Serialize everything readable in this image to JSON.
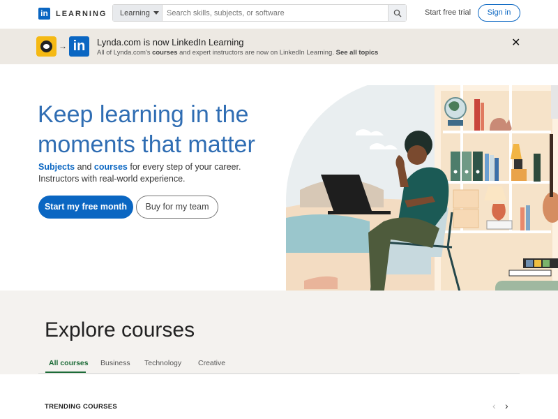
{
  "header": {
    "logo_text": "LEARNING",
    "logo_mark": "in",
    "search": {
      "scope": "Learning",
      "placeholder": "Search skills, subjects, or software"
    },
    "start_trial": "Start free trial",
    "signin": "Sign in"
  },
  "banner": {
    "title": "Lynda.com is now LinkedIn Learning",
    "sub_prefix": "All of Lynda.com's ",
    "sub_courses": "courses",
    "sub_middle": " and expert instructors are now on LinkedIn Learning. ",
    "sub_link": "See all topics",
    "arrow": "→",
    "li_mark": "in",
    "close": "✕"
  },
  "hero": {
    "title": "Keep learning in the moments that matter",
    "desc_subjects": "Subjects",
    "desc_and": " and ",
    "desc_courses": "courses",
    "desc_rest": " for every step of your career. Instructors with real-world experience.",
    "primary_button": "Start my free month",
    "secondary_button": "Buy for my team"
  },
  "explore": {
    "title": "Explore courses",
    "tabs": [
      "All courses",
      "Business",
      "Technology",
      "Creative"
    ],
    "trending": "TRENDING COURSES",
    "prev": "‹",
    "next": "›"
  },
  "colors": {
    "brand_blue": "#0a66c2",
    "title_blue": "#2f6db3",
    "active_tab_green": "#1c6b37",
    "banner_bg": "#ede9e3"
  }
}
